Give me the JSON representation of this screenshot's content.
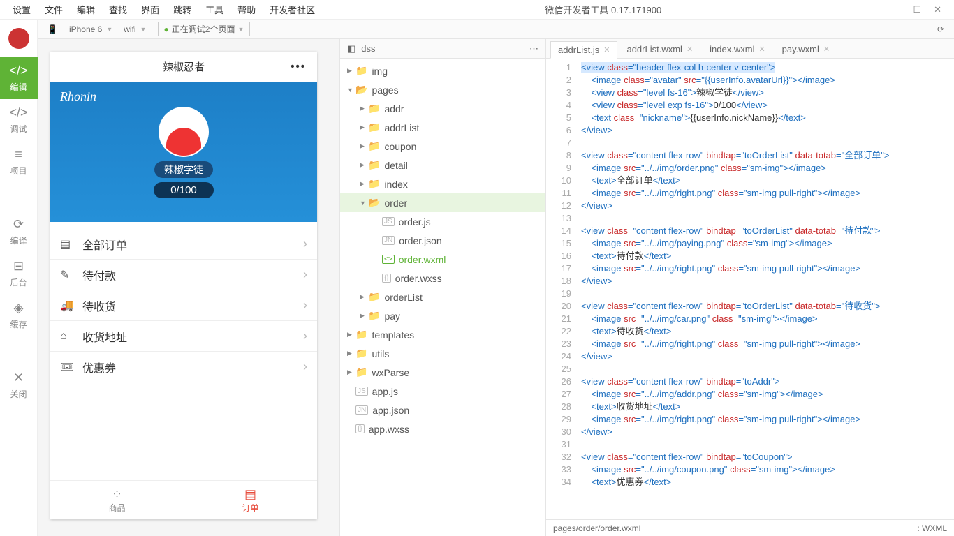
{
  "menubar": {
    "items": [
      "设置",
      "文件",
      "编辑",
      "查找",
      "界面",
      "跳转",
      "工具",
      "帮助",
      "开发者社区"
    ],
    "title": "微信开发者工具 0.17.171900"
  },
  "sidebar": {
    "edit": "编辑",
    "debug": "调试",
    "project": "项目",
    "compile": "编译",
    "backend": "后台",
    "cache": "缓存",
    "close": "关闭"
  },
  "toolbar": {
    "device": "iPhone 6",
    "network": "wifi",
    "status": "正在调试2个页面"
  },
  "phone": {
    "title": "辣椒忍者",
    "heroName": "Rhonin",
    "level": "辣椒学徒",
    "exp": "0/100",
    "menu": [
      "全部订单",
      "待付款",
      "待收货",
      "收货地址",
      "优惠券"
    ],
    "tabGoods": "商品",
    "tabOrder": "订单"
  },
  "explorer": {
    "header": "dss",
    "folders": {
      "img": "img",
      "pages": "pages",
      "addr": "addr",
      "addrList": "addrList",
      "coupon": "coupon",
      "detail": "detail",
      "index": "index",
      "order": "order",
      "orderList": "orderList",
      "pay": "pay",
      "templates": "templates",
      "utils": "utils",
      "wxParse": "wxParse"
    },
    "orderFiles": {
      "js": "order.js",
      "json": "order.json",
      "wxml": "order.wxml",
      "wxss": "order.wxss"
    },
    "appFiles": {
      "js": "app.js",
      "json": "app.json",
      "wxss": "app.wxss"
    }
  },
  "tabs": [
    "addrList.js",
    "addrList.wxml",
    "index.wxml",
    "pay.wxml"
  ],
  "code": {
    "lines": [
      {
        "n": 1,
        "h": [
          [
            "tag",
            "<view "
          ],
          [
            "attr",
            "class"
          ],
          [
            "tag",
            "="
          ],
          [
            "str",
            "\"header flex-col h-center v-center\""
          ],
          [
            "tag",
            ">"
          ]
        ]
      },
      {
        "n": 2,
        "h": [
          [
            "txt",
            "    "
          ],
          [
            "tag",
            "<image "
          ],
          [
            "attr",
            "class"
          ],
          [
            "tag",
            "="
          ],
          [
            "str",
            "\"avatar\""
          ],
          [
            "tag",
            " "
          ],
          [
            "attr",
            "src"
          ],
          [
            "tag",
            "="
          ],
          [
            "str",
            "\"{{userInfo.avatarUrl}}\""
          ],
          [
            "tag",
            "></image>"
          ]
        ]
      },
      {
        "n": 3,
        "h": [
          [
            "txt",
            "    "
          ],
          [
            "tag",
            "<view "
          ],
          [
            "attr",
            "class"
          ],
          [
            "tag",
            "="
          ],
          [
            "str",
            "\"level fs-16\""
          ],
          [
            "tag",
            ">"
          ],
          [
            "txt",
            "辣椒学徒"
          ],
          [
            "tag",
            "</view>"
          ]
        ]
      },
      {
        "n": 4,
        "h": [
          [
            "txt",
            "    "
          ],
          [
            "tag",
            "<view "
          ],
          [
            "attr",
            "class"
          ],
          [
            "tag",
            "="
          ],
          [
            "str",
            "\"level exp fs-16\""
          ],
          [
            "tag",
            ">"
          ],
          [
            "txt",
            "0/100"
          ],
          [
            "tag",
            "</view>"
          ]
        ]
      },
      {
        "n": 5,
        "h": [
          [
            "txt",
            "    "
          ],
          [
            "tag",
            "<text "
          ],
          [
            "attr",
            "class"
          ],
          [
            "tag",
            "="
          ],
          [
            "str",
            "\"nickname\""
          ],
          [
            "tag",
            ">"
          ],
          [
            "txt",
            "{{userInfo.nickName}}"
          ],
          [
            "tag",
            "</text>"
          ]
        ]
      },
      {
        "n": 6,
        "h": [
          [
            "tag",
            "</view>"
          ]
        ]
      },
      {
        "n": 7,
        "h": []
      },
      {
        "n": 8,
        "h": [
          [
            "tag",
            "<view "
          ],
          [
            "attr",
            "class"
          ],
          [
            "tag",
            "="
          ],
          [
            "str",
            "\"content flex-row\""
          ],
          [
            "tag",
            " "
          ],
          [
            "attr",
            "bindtap"
          ],
          [
            "tag",
            "="
          ],
          [
            "str",
            "\"toOrderList\""
          ],
          [
            "tag",
            " "
          ],
          [
            "attr",
            "data-totab"
          ],
          [
            "tag",
            "="
          ],
          [
            "str",
            "\"全部订单\""
          ],
          [
            "tag",
            ">"
          ]
        ]
      },
      {
        "n": 9,
        "h": [
          [
            "txt",
            "    "
          ],
          [
            "tag",
            "<image "
          ],
          [
            "attr",
            "src"
          ],
          [
            "tag",
            "="
          ],
          [
            "str",
            "\"../../img/order.png\""
          ],
          [
            "tag",
            " "
          ],
          [
            "attr",
            "class"
          ],
          [
            "tag",
            "="
          ],
          [
            "str",
            "\"sm-img\""
          ],
          [
            "tag",
            "></image>"
          ]
        ]
      },
      {
        "n": 10,
        "h": [
          [
            "txt",
            "    "
          ],
          [
            "tag",
            "<text>"
          ],
          [
            "txt",
            "全部订单"
          ],
          [
            "tag",
            "</text>"
          ]
        ]
      },
      {
        "n": 11,
        "h": [
          [
            "txt",
            "    "
          ],
          [
            "tag",
            "<image "
          ],
          [
            "attr",
            "src"
          ],
          [
            "tag",
            "="
          ],
          [
            "str",
            "\"../../img/right.png\""
          ],
          [
            "tag",
            " "
          ],
          [
            "attr",
            "class"
          ],
          [
            "tag",
            "="
          ],
          [
            "str",
            "\"sm-img pull-right\""
          ],
          [
            "tag",
            "></image>"
          ]
        ]
      },
      {
        "n": 12,
        "h": [
          [
            "tag",
            "</view>"
          ]
        ]
      },
      {
        "n": 13,
        "h": []
      },
      {
        "n": 14,
        "h": [
          [
            "tag",
            "<view "
          ],
          [
            "attr",
            "class"
          ],
          [
            "tag",
            "="
          ],
          [
            "str",
            "\"content flex-row\""
          ],
          [
            "tag",
            " "
          ],
          [
            "attr",
            "bindtap"
          ],
          [
            "tag",
            "="
          ],
          [
            "str",
            "\"toOrderList\""
          ],
          [
            "tag",
            " "
          ],
          [
            "attr",
            "data-totab"
          ],
          [
            "tag",
            "="
          ],
          [
            "str",
            "\"待付款\""
          ],
          [
            "tag",
            ">"
          ]
        ]
      },
      {
        "n": 15,
        "h": [
          [
            "txt",
            "    "
          ],
          [
            "tag",
            "<image "
          ],
          [
            "attr",
            "src"
          ],
          [
            "tag",
            "="
          ],
          [
            "str",
            "\"../../img/paying.png\""
          ],
          [
            "tag",
            " "
          ],
          [
            "attr",
            "class"
          ],
          [
            "tag",
            "="
          ],
          [
            "str",
            "\"sm-img\""
          ],
          [
            "tag",
            "></image>"
          ]
        ]
      },
      {
        "n": 16,
        "h": [
          [
            "txt",
            "    "
          ],
          [
            "tag",
            "<text>"
          ],
          [
            "txt",
            "待付款"
          ],
          [
            "tag",
            "</text>"
          ]
        ]
      },
      {
        "n": 17,
        "h": [
          [
            "txt",
            "    "
          ],
          [
            "tag",
            "<image "
          ],
          [
            "attr",
            "src"
          ],
          [
            "tag",
            "="
          ],
          [
            "str",
            "\"../../img/right.png\""
          ],
          [
            "tag",
            " "
          ],
          [
            "attr",
            "class"
          ],
          [
            "tag",
            "="
          ],
          [
            "str",
            "\"sm-img pull-right\""
          ],
          [
            "tag",
            "></image>"
          ]
        ]
      },
      {
        "n": 18,
        "h": [
          [
            "tag",
            "</view>"
          ]
        ]
      },
      {
        "n": 19,
        "h": []
      },
      {
        "n": 20,
        "h": [
          [
            "tag",
            "<view "
          ],
          [
            "attr",
            "class"
          ],
          [
            "tag",
            "="
          ],
          [
            "str",
            "\"content flex-row\""
          ],
          [
            "tag",
            " "
          ],
          [
            "attr",
            "bindtap"
          ],
          [
            "tag",
            "="
          ],
          [
            "str",
            "\"toOrderList\""
          ],
          [
            "tag",
            " "
          ],
          [
            "attr",
            "data-totab"
          ],
          [
            "tag",
            "="
          ],
          [
            "str",
            "\"待收货\""
          ],
          [
            "tag",
            ">"
          ]
        ]
      },
      {
        "n": 21,
        "h": [
          [
            "txt",
            "    "
          ],
          [
            "tag",
            "<image "
          ],
          [
            "attr",
            "src"
          ],
          [
            "tag",
            "="
          ],
          [
            "str",
            "\"../../img/car.png\""
          ],
          [
            "tag",
            " "
          ],
          [
            "attr",
            "class"
          ],
          [
            "tag",
            "="
          ],
          [
            "str",
            "\"sm-img\""
          ],
          [
            "tag",
            "></image>"
          ]
        ]
      },
      {
        "n": 22,
        "h": [
          [
            "txt",
            "    "
          ],
          [
            "tag",
            "<text>"
          ],
          [
            "txt",
            "待收货"
          ],
          [
            "tag",
            "</text>"
          ]
        ]
      },
      {
        "n": 23,
        "h": [
          [
            "txt",
            "    "
          ],
          [
            "tag",
            "<image "
          ],
          [
            "attr",
            "src"
          ],
          [
            "tag",
            "="
          ],
          [
            "str",
            "\"../../img/right.png\""
          ],
          [
            "tag",
            " "
          ],
          [
            "attr",
            "class"
          ],
          [
            "tag",
            "="
          ],
          [
            "str",
            "\"sm-img pull-right\""
          ],
          [
            "tag",
            "></image>"
          ]
        ]
      },
      {
        "n": 24,
        "h": [
          [
            "tag",
            "</view>"
          ]
        ]
      },
      {
        "n": 25,
        "h": []
      },
      {
        "n": 26,
        "h": [
          [
            "tag",
            "<view "
          ],
          [
            "attr",
            "class"
          ],
          [
            "tag",
            "="
          ],
          [
            "str",
            "\"content flex-row\""
          ],
          [
            "tag",
            " "
          ],
          [
            "attr",
            "bindtap"
          ],
          [
            "tag",
            "="
          ],
          [
            "str",
            "\"toAddr\""
          ],
          [
            "tag",
            ">"
          ]
        ]
      },
      {
        "n": 27,
        "h": [
          [
            "txt",
            "    "
          ],
          [
            "tag",
            "<image "
          ],
          [
            "attr",
            "src"
          ],
          [
            "tag",
            "="
          ],
          [
            "str",
            "\"../../img/addr.png\""
          ],
          [
            "tag",
            " "
          ],
          [
            "attr",
            "class"
          ],
          [
            "tag",
            "="
          ],
          [
            "str",
            "\"sm-img\""
          ],
          [
            "tag",
            "></image>"
          ]
        ]
      },
      {
        "n": 28,
        "h": [
          [
            "txt",
            "    "
          ],
          [
            "tag",
            "<text>"
          ],
          [
            "txt",
            "收货地址"
          ],
          [
            "tag",
            "</text>"
          ]
        ]
      },
      {
        "n": 29,
        "h": [
          [
            "txt",
            "    "
          ],
          [
            "tag",
            "<image "
          ],
          [
            "attr",
            "src"
          ],
          [
            "tag",
            "="
          ],
          [
            "str",
            "\"../../img/right.png\""
          ],
          [
            "tag",
            " "
          ],
          [
            "attr",
            "class"
          ],
          [
            "tag",
            "="
          ],
          [
            "str",
            "\"sm-img pull-right\""
          ],
          [
            "tag",
            "></image>"
          ]
        ]
      },
      {
        "n": 30,
        "h": [
          [
            "tag",
            "</view>"
          ]
        ]
      },
      {
        "n": 31,
        "h": []
      },
      {
        "n": 32,
        "h": [
          [
            "tag",
            "<view "
          ],
          [
            "attr",
            "class"
          ],
          [
            "tag",
            "="
          ],
          [
            "str",
            "\"content flex-row\""
          ],
          [
            "tag",
            " "
          ],
          [
            "attr",
            "bindtap"
          ],
          [
            "tag",
            "="
          ],
          [
            "str",
            "\"toCoupon\""
          ],
          [
            "tag",
            ">"
          ]
        ]
      },
      {
        "n": 33,
        "h": [
          [
            "txt",
            "    "
          ],
          [
            "tag",
            "<image "
          ],
          [
            "attr",
            "src"
          ],
          [
            "tag",
            "="
          ],
          [
            "str",
            "\"../../img/coupon.png\""
          ],
          [
            "tag",
            " "
          ],
          [
            "attr",
            "class"
          ],
          [
            "tag",
            "="
          ],
          [
            "str",
            "\"sm-img\""
          ],
          [
            "tag",
            "></image>"
          ]
        ]
      },
      {
        "n": 34,
        "h": [
          [
            "txt",
            "    "
          ],
          [
            "tag",
            "<text>"
          ],
          [
            "txt",
            "优惠券"
          ],
          [
            "tag",
            "</text>"
          ]
        ]
      }
    ]
  },
  "statusbar": {
    "path": "pages/order/order.wxml",
    "lang": ":     WXML"
  }
}
